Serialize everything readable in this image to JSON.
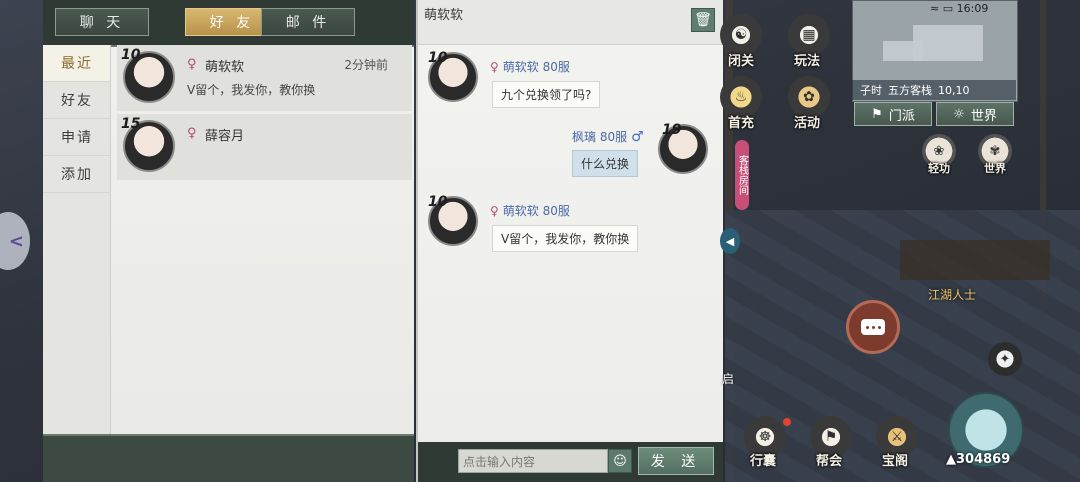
{
  "tabs": [
    {
      "label": "聊 天"
    },
    {
      "label": "好 友"
    },
    {
      "label": "邮 件"
    }
  ],
  "side_nav": [
    {
      "label": "最近"
    },
    {
      "label": "好友"
    },
    {
      "label": "申请"
    },
    {
      "label": "添加"
    }
  ],
  "friends": [
    {
      "level": "10",
      "gender": "♀",
      "name": "萌软软",
      "time": "2分钟前",
      "last_message": "V留个，我发你，教你换"
    },
    {
      "level": "15",
      "gender": "♀",
      "name": "薛容月",
      "time": "",
      "last_message": ""
    }
  ],
  "chat": {
    "title": "萌软软",
    "messages": [
      {
        "level": "10",
        "gender": "♀",
        "sender": "萌软软 80服",
        "text": "九个兑换领了吗?"
      },
      {
        "level": "19",
        "gender": "♂",
        "sender": "枫璃 80服",
        "text": "什么兑换"
      },
      {
        "level": "10",
        "gender": "♀",
        "sender": "萌软软 80服",
        "text": "V留个，我发你，教你换"
      }
    ],
    "input_placeholder": "点击输入内容",
    "send_label": "发 送",
    "trash_icon": "trash-icon",
    "emoji_icon": "smile-icon"
  },
  "hud": {
    "status_time": "16:09",
    "map_time": "子时",
    "map_location": "五方客栈",
    "map_coords": "10,10",
    "sect_button": "门派",
    "world_button": "世界",
    "top_icons": [
      {
        "label": "闭关"
      },
      {
        "label": "玩法"
      },
      {
        "label": "首充"
      },
      {
        "label": "活动"
      }
    ],
    "banner": "客栈房间",
    "qinggong": "轻功",
    "world_chat": "世界",
    "npc_label": "江湖人士",
    "qi_label": "启",
    "bottom_icons": [
      {
        "label": "行囊"
      },
      {
        "label": "帮会"
      },
      {
        "label": "宝阁"
      }
    ],
    "power": "304869"
  },
  "colors": {
    "accent_tab": "#c9a65c",
    "panel_bg": "#efefec",
    "bar_dark": "#2f3a34",
    "female": "#b2506a",
    "male": "#3f6fc4"
  }
}
